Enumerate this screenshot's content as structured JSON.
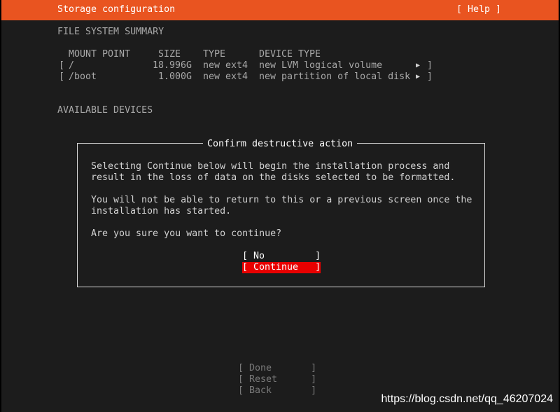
{
  "header": {
    "title": "Storage configuration",
    "help": "[ Help ]"
  },
  "summary": {
    "heading": "FILE SYSTEM SUMMARY",
    "columns": [
      "MOUNT POINT",
      "SIZE",
      "TYPE",
      "DEVICE TYPE"
    ],
    "rows": [
      {
        "bracket_open": "[",
        "mount": "/",
        "size": "18.996G",
        "type": "new ext4",
        "device": "new LVM logical volume",
        "bracket_close": "]"
      },
      {
        "bracket_open": "[",
        "mount": "/boot",
        "size": "1.000G",
        "type": "new ext4",
        "device": "new partition of local disk",
        "bracket_close": "]"
      }
    ]
  },
  "available": {
    "heading": "AVAILABLE DEVICES"
  },
  "dialog": {
    "title": "Confirm destructive action",
    "line1": "Selecting Continue below will begin the installation process and",
    "line2": "result in the loss of data on the disks selected to be formatted.",
    "line3": "You will not be able to return to this or a previous screen once the",
    "line4": "installation has started.",
    "line5": "Are you sure you want to continue?",
    "no_button": "[ No         ]",
    "continue_button": "[ Continue   ]"
  },
  "footer": {
    "done": "[ Done       ]",
    "reset": "[ Reset      ]",
    "back": "[ Back       ]"
  },
  "watermark": "https://blog.csdn.net/qq_46207024",
  "colors": {
    "accent": "#e95420",
    "selected": "#e80000",
    "background": "#1c1c1c"
  }
}
